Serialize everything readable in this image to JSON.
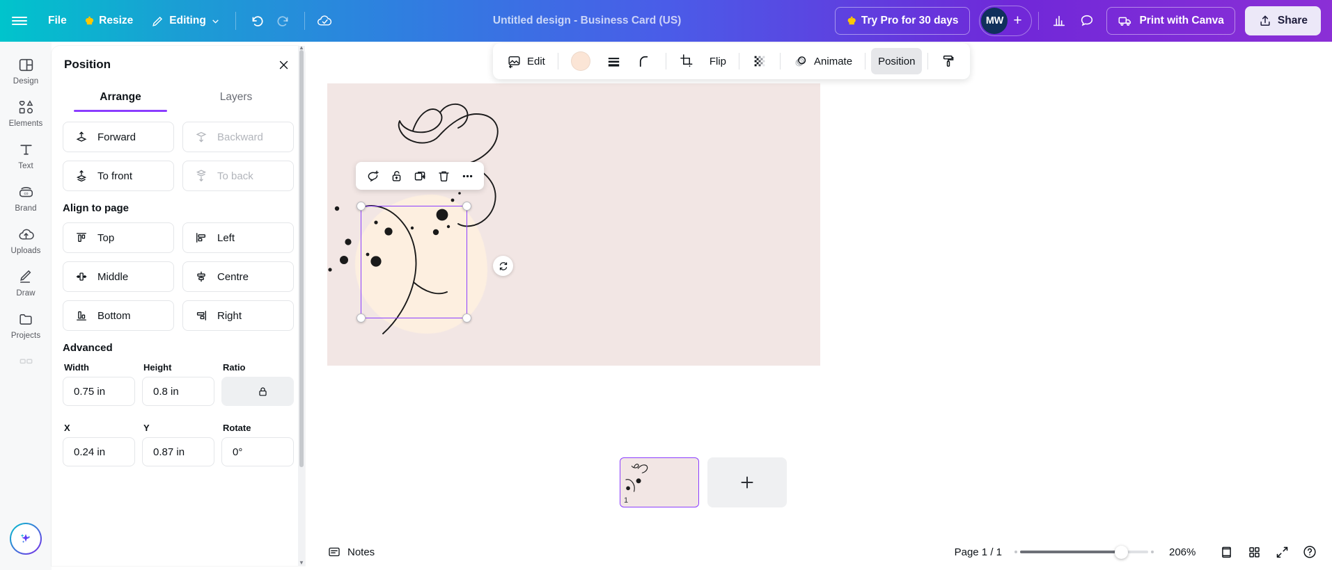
{
  "topbar": {
    "menu_icon": "hamburger-icon",
    "file_label": "File",
    "resize_label": "Resize",
    "editing_label": "Editing",
    "undo_icon": "undo-icon",
    "redo_icon": "redo-icon",
    "cloud_saved_icon": "cloud-check-icon",
    "doc_title": "Untitled design - Business Card (US)",
    "try_pro_label": "Try Pro for 30 days",
    "avatar_initials": "MW",
    "avatar_plus": "+",
    "insights_icon": "bar-chart-icon",
    "comment_icon": "speech-bubble-icon",
    "print_label": "Print with Canva",
    "print_icon": "delivery-truck-icon",
    "share_label": "Share",
    "share_icon": "share-upload-icon"
  },
  "rail": {
    "items": [
      {
        "label": "Design",
        "icon": "design-layout-icon"
      },
      {
        "label": "Elements",
        "icon": "shapes-icon"
      },
      {
        "label": "Text",
        "icon": "text-t-icon"
      },
      {
        "label": "Brand",
        "icon": "brand-icon"
      },
      {
        "label": "Uploads",
        "icon": "cloud-upload-icon"
      },
      {
        "label": "Draw",
        "icon": "pen-draw-icon"
      },
      {
        "label": "Projects",
        "icon": "folder-icon"
      },
      {
        "label": "",
        "icon": "apps-grid-icon"
      }
    ],
    "ai_button_icon": "magic-sparkle-icon"
  },
  "panel": {
    "title": "Position",
    "close_icon": "close-x-icon",
    "tabs": [
      {
        "label": "Arrange",
        "active": true
      },
      {
        "label": "Layers",
        "active": false
      }
    ],
    "order_buttons": [
      {
        "label": "Forward",
        "icon": "arrow-up-layer-icon",
        "disabled": false
      },
      {
        "label": "Backward",
        "icon": "arrow-down-layer-icon",
        "disabled": true
      },
      {
        "label": "To front",
        "icon": "arrow-up-stack-icon",
        "disabled": false
      },
      {
        "label": "To back",
        "icon": "arrow-down-stack-icon",
        "disabled": true
      }
    ],
    "align_title": "Align to page",
    "align_buttons": [
      {
        "label": "Top",
        "icon": "align-top-icon"
      },
      {
        "label": "Left",
        "icon": "align-left-icon"
      },
      {
        "label": "Middle",
        "icon": "align-middle-icon"
      },
      {
        "label": "Centre",
        "icon": "align-centre-icon"
      },
      {
        "label": "Bottom",
        "icon": "align-bottom-icon"
      },
      {
        "label": "Right",
        "icon": "align-right-icon"
      }
    ],
    "advanced_title": "Advanced",
    "fields": {
      "width_label": "Width",
      "width_value": "0.75 in",
      "height_label": "Height",
      "height_value": "0.8 in",
      "ratio_label": "Ratio",
      "ratio_icon": "lock-icon",
      "x_label": "X",
      "x_value": "0.24 in",
      "y_label": "Y",
      "y_value": "0.87 in",
      "rotate_label": "Rotate",
      "rotate_value": "0°"
    }
  },
  "context_toolbar": {
    "edit_label": "Edit",
    "edit_icon": "edit-image-icon",
    "color_swatch": "#fbe5d6",
    "lines_icon": "line-thickness-icon",
    "corner_icon": "corner-radius-icon",
    "crop_icon": "crop-icon",
    "flip_label": "Flip",
    "transparency_icon": "transparency-checker-icon",
    "animate_label": "Animate",
    "animate_icon": "animate-circles-icon",
    "position_label": "Position",
    "more_icon": "paint-roller-icon"
  },
  "element_toolbar": {
    "comment_icon": "comment-add-icon",
    "lock_icon": "unlock-icon",
    "duplicate_icon": "duplicate-icon",
    "delete_icon": "trash-icon",
    "more_icon": "more-dots-icon"
  },
  "canvas": {
    "background_color": "#f2e6e4",
    "blob_color": "#fdefe0",
    "selection_color": "#8b3dff",
    "rotate_icon": "rotate-icon"
  },
  "pages": {
    "page_number": "1",
    "add_page_icon": "plus-icon"
  },
  "bottombar": {
    "notes_label": "Notes",
    "notes_icon": "notes-icon",
    "page_count": "Page 1 / 1",
    "zoom_percent": "206%",
    "zoom_slider_value": 72,
    "fullscreen_icon": "present-screen-icon",
    "grid_icon": "grid-view-icon",
    "expand_icon": "expand-arrows-icon",
    "help_icon": "help-question-icon"
  }
}
